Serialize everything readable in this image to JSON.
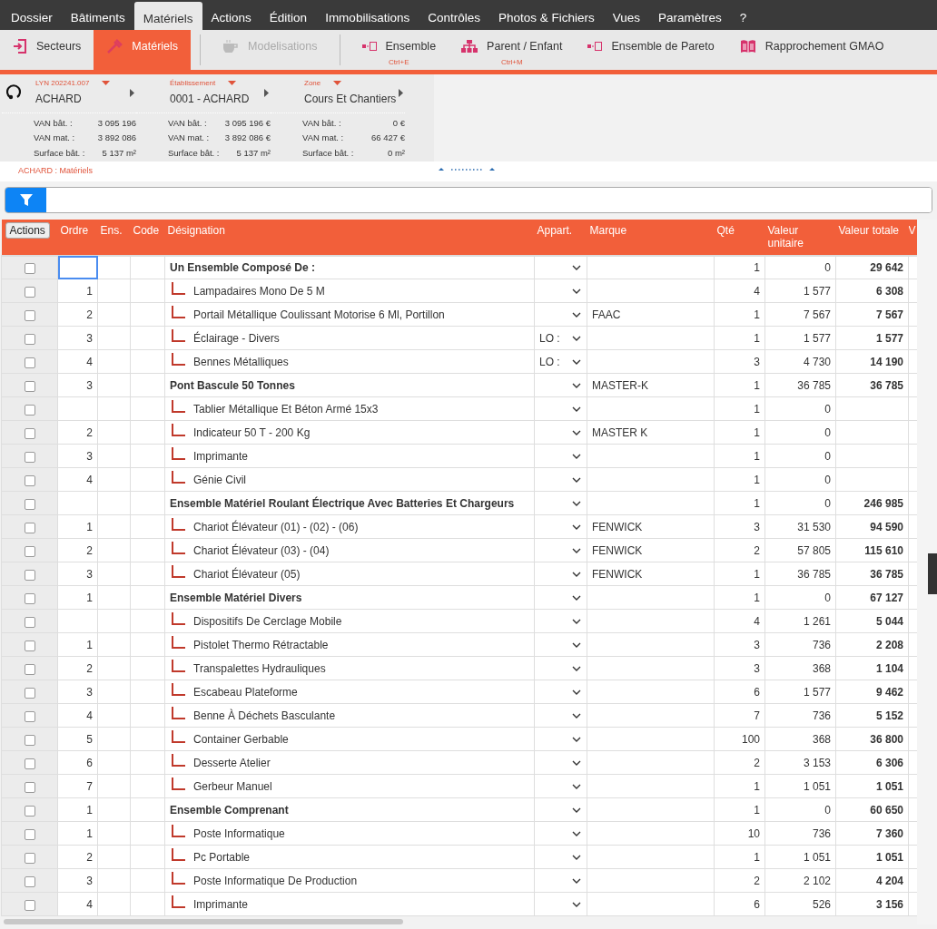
{
  "menu": [
    {
      "label": "Dossier",
      "selected": false
    },
    {
      "label": "Bâtiments",
      "selected": false
    },
    {
      "label": "Matériels",
      "selected": true
    },
    {
      "label": "Actions",
      "selected": false
    },
    {
      "label": "Édition",
      "selected": false
    },
    {
      "label": "Immobilisations",
      "selected": false
    },
    {
      "label": "Contrôles",
      "selected": false
    },
    {
      "label": "Photos & Fichiers",
      "selected": false
    },
    {
      "label": "Vues",
      "selected": false
    },
    {
      "label": "Paramètres",
      "selected": false
    },
    {
      "label": "?",
      "selected": false
    }
  ],
  "toolbar": [
    {
      "kind": "secteurs",
      "label": "Secteurs",
      "selected": false,
      "disabled": false
    },
    {
      "kind": "materiels",
      "label": "Matériels",
      "selected": true,
      "disabled": false
    },
    {
      "kind": "separator"
    },
    {
      "kind": "modelisations",
      "label": "Modelisations",
      "selected": false,
      "disabled": true
    },
    {
      "kind": "separator"
    },
    {
      "kind": "ensemble",
      "label": "Ensemble",
      "shortcut": "Ctrl+E",
      "selected": false,
      "disabled": false
    },
    {
      "kind": "parent",
      "label": "Parent / Enfant",
      "shortcut": "Ctrl+M",
      "selected": false,
      "disabled": false
    },
    {
      "kind": "ensemble",
      "label": "Ensemble de Pareto",
      "selected": false,
      "disabled": false
    },
    {
      "kind": "book",
      "label": "Rapprochement GMAO",
      "selected": false,
      "disabled": false
    }
  ],
  "context": [
    {
      "caption": "LYN 202241.007",
      "value": "ACHARD",
      "stats": [
        [
          "VAN bât. :",
          "3 095 196"
        ],
        [
          "VAN mat. :",
          "3 892 086"
        ],
        [
          "Surface bât. :",
          "5 137 m²"
        ]
      ]
    },
    {
      "caption": "Établissement",
      "value": "0001 - ACHARD",
      "stats": [
        [
          "VAN bât. :",
          "3 095 196 €"
        ],
        [
          "VAN mat. :",
          "3 892 086 €"
        ],
        [
          "Surface bât. :",
          "5 137 m²"
        ]
      ]
    },
    {
      "caption": "Zone",
      "value": "Cours Et Chantiers",
      "stats": [
        [
          "VAN bât. :",
          "0 €"
        ],
        [
          "VAN mat. :",
          "66 427 €"
        ],
        [
          "Surface bât. :",
          "0 m²"
        ]
      ]
    }
  ],
  "breadcrumb": "ACHARD : Matériels",
  "table": {
    "actions_button": "Actions",
    "columns": [
      "Ordre",
      "Ens.",
      "Code",
      "Désignation",
      "Appart.",
      "Marque",
      "Qté",
      "Valeur unitaire",
      "Valeur totale",
      "V"
    ],
    "rows": [
      {
        "kind": "group",
        "selected": true,
        "checked": false,
        "ordre": "",
        "designation": "Un Ensemble Composé De :",
        "appart": "",
        "marque": "",
        "qte": "1",
        "vu": "0",
        "vt": "29 642"
      },
      {
        "kind": "child",
        "selected": false,
        "checked": false,
        "ordre": "1",
        "designation": "Lampadaires Mono De 5 M",
        "appart": "",
        "marque": "",
        "qte": "4",
        "vu": "1 577",
        "vt": "6 308"
      },
      {
        "kind": "child",
        "selected": false,
        "checked": false,
        "ordre": "2",
        "designation": "Portail Métallique Coulissant Motorise 6 Ml, Portillon",
        "appart": "",
        "marque": "FAAC",
        "qte": "1",
        "vu": "7 567",
        "vt": "7 567"
      },
      {
        "kind": "child",
        "selected": false,
        "checked": false,
        "ordre": "3",
        "designation": "Éclairage - Divers",
        "appart": "LO :",
        "marque": "",
        "qte": "1",
        "vu": "1 577",
        "vt": "1 577"
      },
      {
        "kind": "child",
        "selected": false,
        "checked": false,
        "ordre": "4",
        "designation": "Bennes Métalliques",
        "appart": "LO :",
        "marque": "",
        "qte": "3",
        "vu": "4 730",
        "vt": "14 190"
      },
      {
        "kind": "group",
        "selected": false,
        "checked": false,
        "ordre": "3",
        "designation": "Pont Bascule 50 Tonnes",
        "appart": "",
        "marque": "MASTER-K",
        "qte": "1",
        "vu": "36 785",
        "vt": "36 785"
      },
      {
        "kind": "child",
        "selected": false,
        "checked": false,
        "ordre": "",
        "designation": "Tablier Métallique Et Béton Armé 15x3",
        "appart": "",
        "marque": "",
        "qte": "1",
        "vu": "0",
        "vt": ""
      },
      {
        "kind": "child",
        "selected": false,
        "checked": false,
        "ordre": "2",
        "designation": "Indicateur 50 T - 200 Kg",
        "appart": "",
        "marque": "MASTER K",
        "qte": "1",
        "vu": "0",
        "vt": ""
      },
      {
        "kind": "child",
        "selected": false,
        "checked": false,
        "ordre": "3",
        "designation": "Imprimante",
        "appart": "",
        "marque": "",
        "qte": "1",
        "vu": "0",
        "vt": ""
      },
      {
        "kind": "child",
        "selected": false,
        "checked": false,
        "ordre": "4",
        "designation": "Génie Civil",
        "appart": "",
        "marque": "",
        "qte": "1",
        "vu": "0",
        "vt": ""
      },
      {
        "kind": "group",
        "selected": false,
        "checked": false,
        "ordre": "",
        "designation": "Ensemble Matériel Roulant Électrique Avec Batteries Et Chargeurs",
        "appart": "",
        "marque": "",
        "qte": "1",
        "vu": "0",
        "vt": "246 985"
      },
      {
        "kind": "child",
        "selected": false,
        "checked": false,
        "ordre": "1",
        "designation": "Chariot Élévateur (01) - (02) - (06)",
        "appart": "",
        "marque": "FENWICK",
        "qte": "3",
        "vu": "31 530",
        "vt": "94 590"
      },
      {
        "kind": "child",
        "selected": false,
        "checked": false,
        "ordre": "2",
        "designation": "Chariot Élévateur (03) - (04)",
        "appart": "",
        "marque": "FENWICK",
        "qte": "2",
        "vu": "57 805",
        "vt": "115 610"
      },
      {
        "kind": "child",
        "selected": false,
        "checked": false,
        "ordre": "3",
        "designation": "Chariot Élévateur (05)",
        "appart": "",
        "marque": "FENWICK",
        "qte": "1",
        "vu": "36 785",
        "vt": "36 785"
      },
      {
        "kind": "group",
        "selected": false,
        "checked": false,
        "ordre": "1",
        "designation": "Ensemble Matériel Divers",
        "appart": "",
        "marque": "",
        "qte": "1",
        "vu": "0",
        "vt": "67 127"
      },
      {
        "kind": "child",
        "selected": false,
        "checked": false,
        "ordre": "",
        "designation": "Dispositifs De Cerclage Mobile",
        "appart": "",
        "marque": "",
        "qte": "4",
        "vu": "1 261",
        "vt": "5 044"
      },
      {
        "kind": "child",
        "selected": false,
        "checked": false,
        "ordre": "1",
        "designation": "Pistolet Thermo Rétractable",
        "appart": "",
        "marque": "",
        "qte": "3",
        "vu": "736",
        "vt": "2 208"
      },
      {
        "kind": "child",
        "selected": false,
        "checked": false,
        "ordre": "2",
        "designation": "Transpalettes Hydrauliques",
        "appart": "",
        "marque": "",
        "qte": "3",
        "vu": "368",
        "vt": "1 104"
      },
      {
        "kind": "child",
        "selected": false,
        "checked": false,
        "ordre": "3",
        "designation": "Escabeau Plateforme",
        "appart": "",
        "marque": "",
        "qte": "6",
        "vu": "1 577",
        "vt": "9 462"
      },
      {
        "kind": "child",
        "selected": false,
        "checked": false,
        "ordre": "4",
        "designation": "Benne À Déchets Basculante",
        "appart": "",
        "marque": "",
        "qte": "7",
        "vu": "736",
        "vt": "5 152"
      },
      {
        "kind": "child",
        "selected": false,
        "checked": false,
        "ordre": "5",
        "designation": "Container Gerbable",
        "appart": "",
        "marque": "",
        "qte": "100",
        "vu": "368",
        "vt": "36 800"
      },
      {
        "kind": "child",
        "selected": false,
        "checked": false,
        "ordre": "6",
        "designation": "Desserte Atelier",
        "appart": "",
        "marque": "",
        "qte": "2",
        "vu": "3 153",
        "vt": "6 306"
      },
      {
        "kind": "child",
        "selected": false,
        "checked": false,
        "ordre": "7",
        "designation": "Gerbeur Manuel",
        "appart": "",
        "marque": "",
        "qte": "1",
        "vu": "1 051",
        "vt": "1 051"
      },
      {
        "kind": "group",
        "selected": false,
        "checked": false,
        "ordre": "1",
        "designation": "Ensemble Comprenant",
        "appart": "",
        "marque": "",
        "qte": "1",
        "vu": "0",
        "vt": "60 650"
      },
      {
        "kind": "child",
        "selected": false,
        "checked": false,
        "ordre": "1",
        "designation": "Poste Informatique",
        "appart": "",
        "marque": "",
        "qte": "10",
        "vu": "736",
        "vt": "7 360"
      },
      {
        "kind": "child",
        "selected": false,
        "checked": false,
        "ordre": "2",
        "designation": "Pc Portable",
        "appart": "",
        "marque": "",
        "qte": "1",
        "vu": "1 051",
        "vt": "1 051"
      },
      {
        "kind": "child",
        "selected": false,
        "checked": false,
        "ordre": "3",
        "designation": "Poste Informatique De Production",
        "appart": "",
        "marque": "",
        "qte": "2",
        "vu": "2 102",
        "vt": "4 204"
      },
      {
        "kind": "child",
        "selected": false,
        "checked": false,
        "ordre": "4",
        "designation": "Imprimante",
        "appart": "",
        "marque": "",
        "qte": "6",
        "vu": "526",
        "vt": "3 156"
      }
    ]
  }
}
